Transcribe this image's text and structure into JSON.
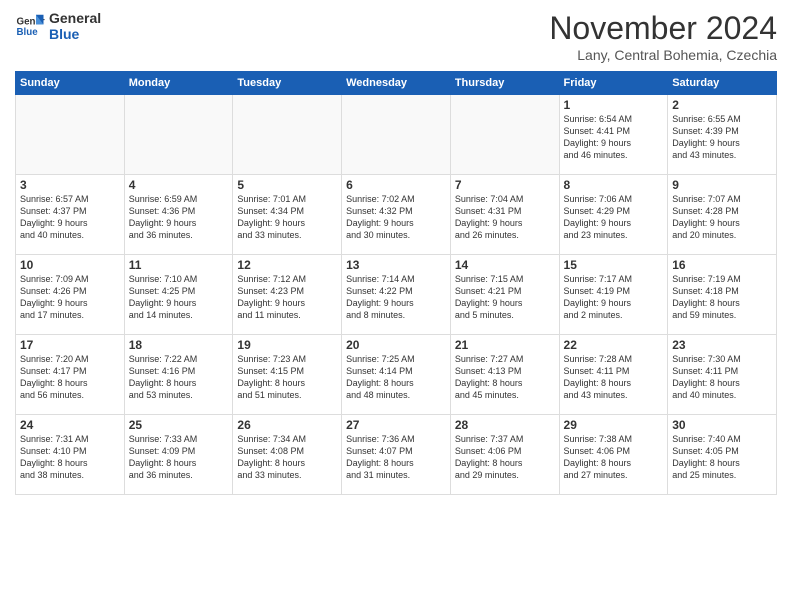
{
  "logo": {
    "line1": "General",
    "line2": "Blue"
  },
  "title": "November 2024",
  "location": "Lany, Central Bohemia, Czechia",
  "days_of_week": [
    "Sunday",
    "Monday",
    "Tuesday",
    "Wednesday",
    "Thursday",
    "Friday",
    "Saturday"
  ],
  "weeks": [
    [
      {
        "day": "",
        "info": ""
      },
      {
        "day": "",
        "info": ""
      },
      {
        "day": "",
        "info": ""
      },
      {
        "day": "",
        "info": ""
      },
      {
        "day": "",
        "info": ""
      },
      {
        "day": "1",
        "info": "Sunrise: 6:54 AM\nSunset: 4:41 PM\nDaylight: 9 hours\nand 46 minutes."
      },
      {
        "day": "2",
        "info": "Sunrise: 6:55 AM\nSunset: 4:39 PM\nDaylight: 9 hours\nand 43 minutes."
      }
    ],
    [
      {
        "day": "3",
        "info": "Sunrise: 6:57 AM\nSunset: 4:37 PM\nDaylight: 9 hours\nand 40 minutes."
      },
      {
        "day": "4",
        "info": "Sunrise: 6:59 AM\nSunset: 4:36 PM\nDaylight: 9 hours\nand 36 minutes."
      },
      {
        "day": "5",
        "info": "Sunrise: 7:01 AM\nSunset: 4:34 PM\nDaylight: 9 hours\nand 33 minutes."
      },
      {
        "day": "6",
        "info": "Sunrise: 7:02 AM\nSunset: 4:32 PM\nDaylight: 9 hours\nand 30 minutes."
      },
      {
        "day": "7",
        "info": "Sunrise: 7:04 AM\nSunset: 4:31 PM\nDaylight: 9 hours\nand 26 minutes."
      },
      {
        "day": "8",
        "info": "Sunrise: 7:06 AM\nSunset: 4:29 PM\nDaylight: 9 hours\nand 23 minutes."
      },
      {
        "day": "9",
        "info": "Sunrise: 7:07 AM\nSunset: 4:28 PM\nDaylight: 9 hours\nand 20 minutes."
      }
    ],
    [
      {
        "day": "10",
        "info": "Sunrise: 7:09 AM\nSunset: 4:26 PM\nDaylight: 9 hours\nand 17 minutes."
      },
      {
        "day": "11",
        "info": "Sunrise: 7:10 AM\nSunset: 4:25 PM\nDaylight: 9 hours\nand 14 minutes."
      },
      {
        "day": "12",
        "info": "Sunrise: 7:12 AM\nSunset: 4:23 PM\nDaylight: 9 hours\nand 11 minutes."
      },
      {
        "day": "13",
        "info": "Sunrise: 7:14 AM\nSunset: 4:22 PM\nDaylight: 9 hours\nand 8 minutes."
      },
      {
        "day": "14",
        "info": "Sunrise: 7:15 AM\nSunset: 4:21 PM\nDaylight: 9 hours\nand 5 minutes."
      },
      {
        "day": "15",
        "info": "Sunrise: 7:17 AM\nSunset: 4:19 PM\nDaylight: 9 hours\nand 2 minutes."
      },
      {
        "day": "16",
        "info": "Sunrise: 7:19 AM\nSunset: 4:18 PM\nDaylight: 8 hours\nand 59 minutes."
      }
    ],
    [
      {
        "day": "17",
        "info": "Sunrise: 7:20 AM\nSunset: 4:17 PM\nDaylight: 8 hours\nand 56 minutes."
      },
      {
        "day": "18",
        "info": "Sunrise: 7:22 AM\nSunset: 4:16 PM\nDaylight: 8 hours\nand 53 minutes."
      },
      {
        "day": "19",
        "info": "Sunrise: 7:23 AM\nSunset: 4:15 PM\nDaylight: 8 hours\nand 51 minutes."
      },
      {
        "day": "20",
        "info": "Sunrise: 7:25 AM\nSunset: 4:14 PM\nDaylight: 8 hours\nand 48 minutes."
      },
      {
        "day": "21",
        "info": "Sunrise: 7:27 AM\nSunset: 4:13 PM\nDaylight: 8 hours\nand 45 minutes."
      },
      {
        "day": "22",
        "info": "Sunrise: 7:28 AM\nSunset: 4:11 PM\nDaylight: 8 hours\nand 43 minutes."
      },
      {
        "day": "23",
        "info": "Sunrise: 7:30 AM\nSunset: 4:11 PM\nDaylight: 8 hours\nand 40 minutes."
      }
    ],
    [
      {
        "day": "24",
        "info": "Sunrise: 7:31 AM\nSunset: 4:10 PM\nDaylight: 8 hours\nand 38 minutes."
      },
      {
        "day": "25",
        "info": "Sunrise: 7:33 AM\nSunset: 4:09 PM\nDaylight: 8 hours\nand 36 minutes."
      },
      {
        "day": "26",
        "info": "Sunrise: 7:34 AM\nSunset: 4:08 PM\nDaylight: 8 hours\nand 33 minutes."
      },
      {
        "day": "27",
        "info": "Sunrise: 7:36 AM\nSunset: 4:07 PM\nDaylight: 8 hours\nand 31 minutes."
      },
      {
        "day": "28",
        "info": "Sunrise: 7:37 AM\nSunset: 4:06 PM\nDaylight: 8 hours\nand 29 minutes."
      },
      {
        "day": "29",
        "info": "Sunrise: 7:38 AM\nSunset: 4:06 PM\nDaylight: 8 hours\nand 27 minutes."
      },
      {
        "day": "30",
        "info": "Sunrise: 7:40 AM\nSunset: 4:05 PM\nDaylight: 8 hours\nand 25 minutes."
      }
    ]
  ]
}
